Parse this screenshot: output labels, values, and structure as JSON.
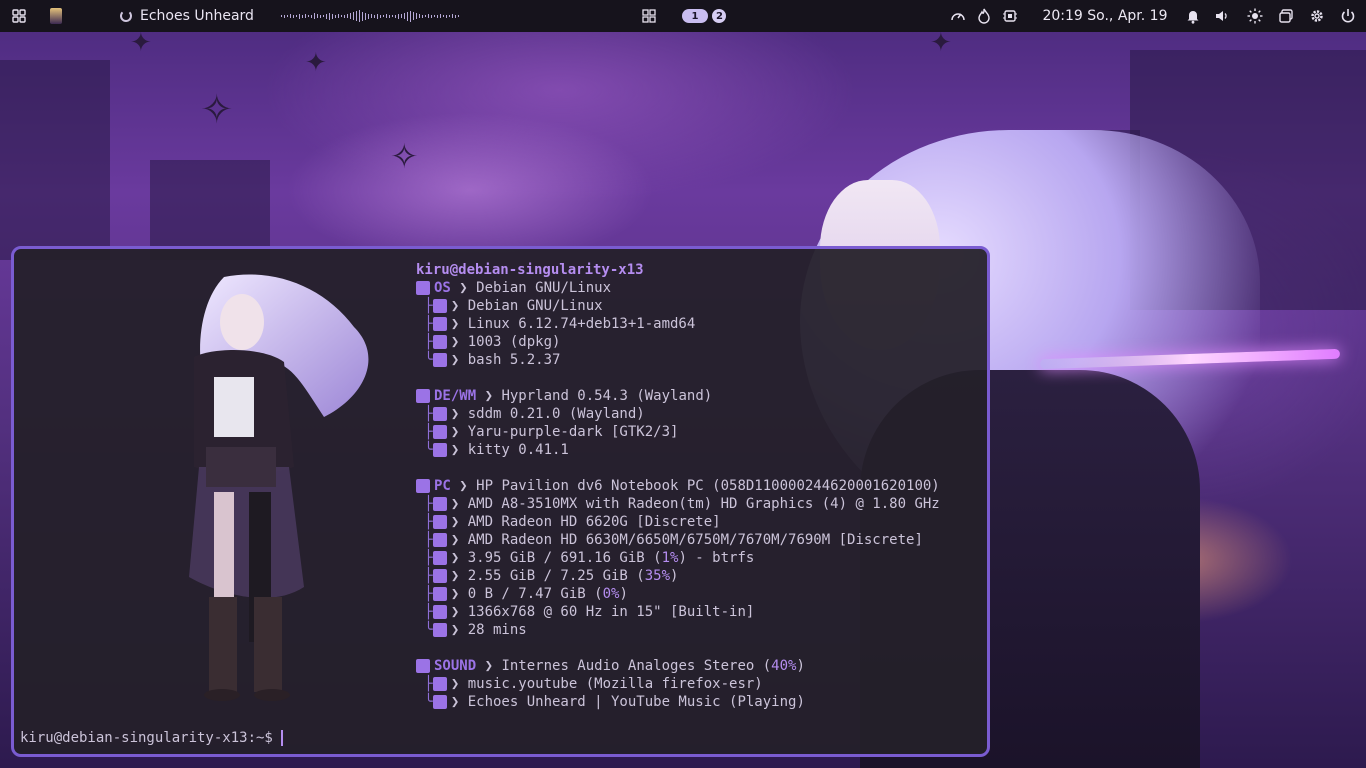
{
  "topbar": {
    "media": {
      "title": "Echoes Unheard"
    },
    "workspaces": [
      {
        "label": "1",
        "active": true
      },
      {
        "label": "2",
        "active": false
      }
    ],
    "clock": "20:19 So., Apr. 19",
    "tray_icons": [
      "gauge-icon",
      "flame-icon",
      "cpu-icon"
    ],
    "system_icons": [
      "bell-icon",
      "volume-icon",
      "brightness-icon",
      "window-icon",
      "settings-icon"
    ]
  },
  "terminal": {
    "userhost": "kiru@debian-singularity-x13",
    "sections": [
      {
        "key": "OS",
        "icon": "debian-icon",
        "value": "Debian GNU/Linux",
        "rows": [
          {
            "icon": "debian-icon",
            "text": "Debian GNU/Linux"
          },
          {
            "icon": "gear-icon",
            "text": "Linux 6.12.74+deb13+1-amd64"
          },
          {
            "icon": "package-icon",
            "text": "1003 (dpkg)"
          },
          {
            "icon": "shell-icon",
            "text": "bash 5.2.37"
          }
        ]
      },
      {
        "key": "DE/WM",
        "icon": "window-icon",
        "value": "Hyprland 0.54.3 (Wayland)",
        "rows": [
          {
            "icon": "monitor-icon",
            "text": "sddm 0.21.0 (Wayland)"
          },
          {
            "icon": "grid-icon",
            "text": "Yaru-purple-dark [GTK2/3]"
          },
          {
            "icon": "terminal-icon",
            "text": "kitty 0.41.1"
          }
        ]
      },
      {
        "key": "PC",
        "icon": "laptop-icon",
        "value": "HP Pavilion dv6 Notebook PC (058D110000244620001620100)",
        "rows": [
          {
            "icon": "cpu-icon",
            "text": "AMD A8-3510MX with Radeon(tm) HD Graphics (4) @ 1.80 GHz"
          },
          {
            "icon": "gpu-icon",
            "text": "AMD Radeon HD 6620G [Discrete]"
          },
          {
            "icon": "gpu-icon",
            "text": "AMD Radeon HD 6630M/6650M/6750M/7670M/7690M [Discrete]"
          },
          {
            "icon": "disk-icon",
            "text_pre": "3.95 GiB / 691.16 GiB (",
            "hl": "1%",
            "text_post": ") - btrfs"
          },
          {
            "icon": "memory-icon",
            "text_pre": "2.55 GiB / 7.25 GiB (",
            "hl": "35%",
            "text_post": ")"
          },
          {
            "icon": "swap-icon",
            "text_pre": "0 B / 7.47 GiB (",
            "hl": "0%",
            "text_post": ")"
          },
          {
            "icon": "display-icon",
            "text": "1366x768 @ 60 Hz in 15\" [Built-in]"
          },
          {
            "icon": "clock-icon",
            "text": "28 mins"
          }
        ]
      },
      {
        "key": "SOUND",
        "icon": "speaker-icon",
        "value_pre": "Internes Audio Analoges Stereo (",
        "value_hl": "40%",
        "value_post": ")",
        "rows": [
          {
            "icon": "player-icon",
            "text": "music.youtube (Mozilla firefox-esr)"
          },
          {
            "icon": "music-icon",
            "text": "Echoes Unheard | YouTube Music (Playing)"
          }
        ]
      }
    ],
    "prompt": "kiru@debian-singularity-x13:~$"
  }
}
